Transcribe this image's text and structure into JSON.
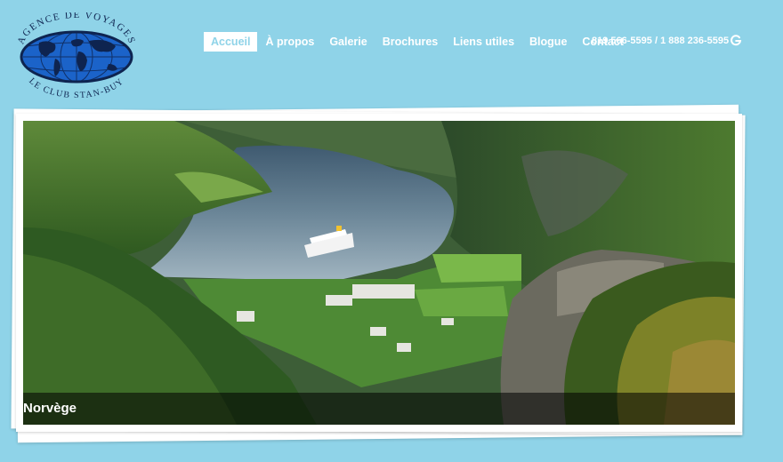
{
  "logo": {
    "top_text": "AGENCE DE VOYAGES",
    "bottom_text": "LE CLUB STAN-BUY"
  },
  "nav": {
    "items": [
      {
        "label": "Accueil",
        "active": true
      },
      {
        "label": "À propos"
      },
      {
        "label": "Galerie"
      },
      {
        "label": "Brochures"
      },
      {
        "label": "Liens utiles"
      },
      {
        "label": "Blogue"
      },
      {
        "label": "Contact"
      }
    ],
    "phone": "819 566-5595 / 1 888 236-5595",
    "icon": "google-plus-icon"
  },
  "slideshow": {
    "caption": "Norvège"
  },
  "colors": {
    "background": "#8fd3e8",
    "accent": "#8fd3e8",
    "text": "#ffffff"
  }
}
